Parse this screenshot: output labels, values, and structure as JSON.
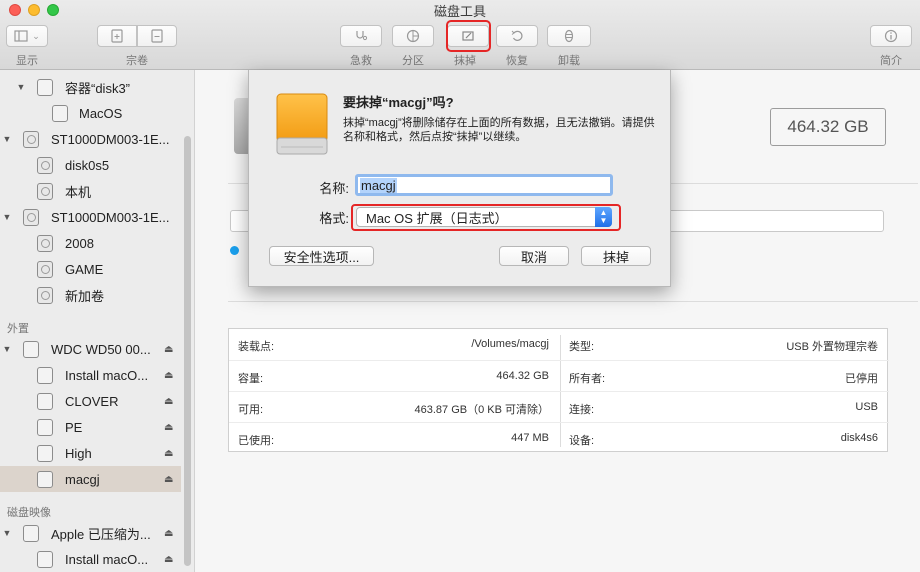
{
  "window": {
    "title": "磁盘工具"
  },
  "toolbar": {
    "show_label": "显示",
    "volume_label": "宗卷",
    "firstaid_label": "急救",
    "partition_label": "分区",
    "erase_label": "抹掉",
    "restore_label": "恢复",
    "unmount_label": "卸载",
    "info_label": "简介"
  },
  "sidebar": {
    "section_external": "外置",
    "section_images": "磁盘映像",
    "items": [
      {
        "label": "容器“disk3”"
      },
      {
        "label": "MacOS"
      },
      {
        "label": "ST1000DM003-1E..."
      },
      {
        "label": "disk0s5"
      },
      {
        "label": "本机"
      },
      {
        "label": "ST1000DM003-1E..."
      },
      {
        "label": "2008"
      },
      {
        "label": "GAME"
      },
      {
        "label": "新加卷"
      },
      {
        "label": "WDC WD50 00..."
      },
      {
        "label": "Install macO..."
      },
      {
        "label": "CLOVER"
      },
      {
        "label": "PE"
      },
      {
        "label": "High"
      },
      {
        "label": "macgj"
      },
      {
        "label": "Apple 已压缩为..."
      },
      {
        "label": "Install macO..."
      }
    ]
  },
  "main": {
    "capacity": "464.32 GB",
    "info": {
      "mount_label": "装载点:",
      "mount_value": "/Volumes/macgj",
      "type_label": "类型:",
      "type_value": "USB 外置物理宗卷",
      "capacity_label": "容量:",
      "capacity_value": "464.32 GB",
      "owners_label": "所有者:",
      "owners_value": "已停用",
      "available_label": "可用:",
      "available_value": "463.87 GB（0 KB 可清除）",
      "connection_label": "连接:",
      "connection_value": "USB",
      "used_label": "已使用:",
      "used_value": "447 MB",
      "device_label": "设备:",
      "device_value": "disk4s6"
    }
  },
  "dialog": {
    "title": "要抹掉“macgj”吗?",
    "description": "抹掉“macgj”将删除储存在上面的所有数据，且无法撤销。请提供名称和格式，然后点按“抹掉”以继续。",
    "name_label": "名称:",
    "name_value": "macgj",
    "format_label": "格式:",
    "format_value": "Mac OS 扩展（日志式）",
    "security_button": "安全性选项...",
    "cancel_button": "取消",
    "erase_button": "抹掉"
  }
}
